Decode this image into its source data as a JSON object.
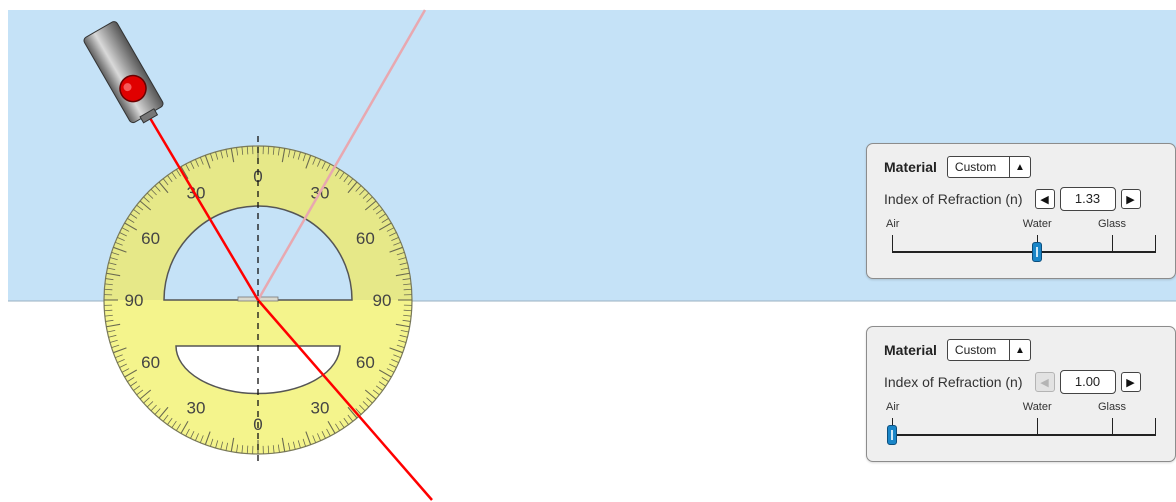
{
  "scene": {
    "top_medium_color": "#c5e2f7",
    "bottom_medium_color": "#ffffff",
    "boundary_color": "#9ab0c2",
    "incident_ray_color": "#ff0000",
    "reflected_ray_color": "#e8a8b0",
    "laser_body_color": "#8f8f8f",
    "laser_button_color": "#e00000"
  },
  "protractor": {
    "face_color": "#f4f48c",
    "upper_face_color": "#e6e888",
    "outline_color": "#7a7a5a",
    "labels": [
      {
        "text": "0",
        "angle": 0
      },
      {
        "text": "30",
        "angle": 30
      },
      {
        "text": "60",
        "angle": 60
      },
      {
        "text": "90",
        "angle": 90
      },
      {
        "text": "60",
        "angle": 120
      },
      {
        "text": "30",
        "angle": 150
      },
      {
        "text": "0",
        "angle": 180
      },
      {
        "text": "30",
        "angle": 210
      },
      {
        "text": "60",
        "angle": 240
      },
      {
        "text": "90",
        "angle": 270
      },
      {
        "text": "60",
        "angle": 300
      },
      {
        "text": "30",
        "angle": 330
      }
    ]
  },
  "top_panel": {
    "material_label": "Material",
    "material_value": "Custom",
    "material_arrow": "▲",
    "ior_label": "Index of Refraction (n)",
    "ior_value": "1.33",
    "ior_value_number": 1.33,
    "left_arrow": "◀",
    "right_arrow": "▶",
    "left_disabled": false,
    "tick_labels": [
      {
        "text": "Air",
        "n": 1.0
      },
      {
        "text": "Water",
        "n": 1.33
      },
      {
        "text": "Glass",
        "n": 1.5
      }
    ]
  },
  "bottom_panel": {
    "material_label": "Material",
    "material_value": "Custom",
    "material_arrow": "▲",
    "ior_label": "Index of Refraction (n)",
    "ior_value": "1.00",
    "ior_value_number": 1.0,
    "left_arrow": "◀",
    "right_arrow": "▶",
    "left_disabled": true,
    "tick_labels": [
      {
        "text": "Air",
        "n": 1.0
      },
      {
        "text": "Water",
        "n": 1.33
      },
      {
        "text": "Glass",
        "n": 1.5
      }
    ]
  }
}
